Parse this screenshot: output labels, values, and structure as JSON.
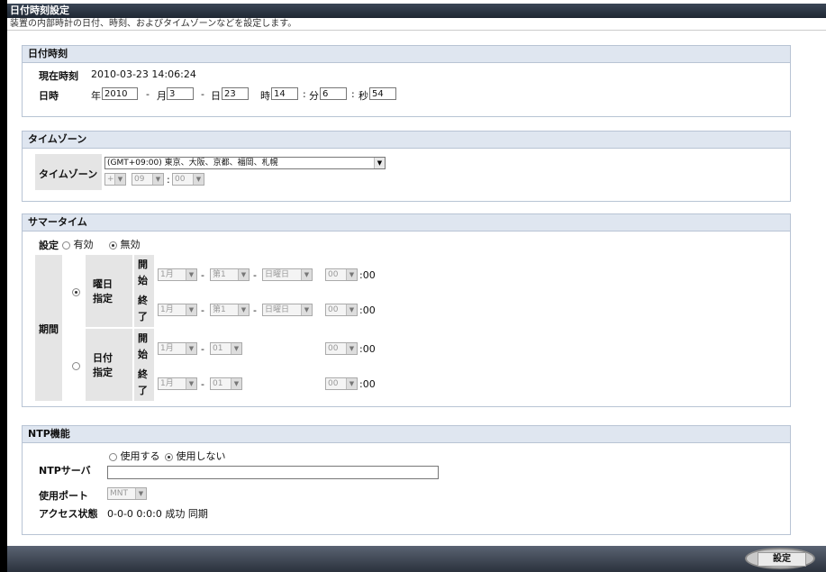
{
  "window": {
    "title": "日付時刻設定",
    "description": "装置の内部時計の日付、時刻、およびタイムゾーンなどを設定します。"
  },
  "datetime": {
    "heading": "日付時刻",
    "current_label": "現在時刻",
    "current_value": "2010-03-23 14:06:24",
    "date_label": "日時",
    "year_label": "年",
    "year": "2010",
    "month_label": "月",
    "month": "3",
    "day_label": "日",
    "day": "23",
    "hour_label": "時",
    "hour": "14",
    "minute_label": "分",
    "minute": "6",
    "second_label": "秒",
    "second": "54",
    "sep": "-",
    "colon": ":"
  },
  "timezone": {
    "heading": "タイムゾーン",
    "label": "タイムゾーン",
    "selected": "(GMT+09:00) 東京、大阪、京都、福岡、札幌",
    "sign": "+",
    "hours": "09",
    "minutes": "00",
    "colon": ":"
  },
  "summer": {
    "heading": "サマータイム",
    "setting_label": "設定",
    "enable": "有効",
    "disable": "無効",
    "selected": "無効",
    "period_label": "期間",
    "weekday_mode_line1": "曜日",
    "weekday_mode_line2": "指定",
    "date_mode_line1": "日付",
    "date_mode_line2": "指定",
    "start_label": [
      "開",
      "始"
    ],
    "end_label": [
      "終",
      "了"
    ],
    "month": "1月",
    "week": "第1",
    "weekday": "日曜日",
    "day": "01",
    "hour": "00",
    "min_suffix": ":00",
    "sep": "-"
  },
  "ntp": {
    "heading": "NTP機能",
    "server_label": "NTPサーバ",
    "use": "使用する",
    "not_use": "使用しない",
    "selected": "使用しない",
    "server_value": "",
    "port_label": "使用ポート",
    "port": "MNT",
    "access_label": "アクセス状態",
    "access_value": "0-0-0 0:0:0 成功 同期"
  },
  "footer": {
    "set_button": "設定"
  }
}
